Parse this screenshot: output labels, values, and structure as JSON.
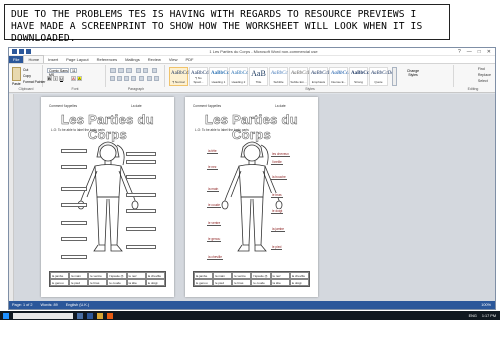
{
  "note": {
    "text": "DUE TO THE PROBLEMS TES IS HAVING WITH REGARDS TO RESOURCE PREVIEWS I HAVE MADE A SCREENPRINT TO SHOW HOW THE WORKSHEET WILL LOOK WHEN IT IS DOWNLOADED."
  },
  "window": {
    "title": "1 Les Parties du Corps - Microsoft Word non-commercial use",
    "controls": [
      "?",
      "—",
      "□",
      "✕"
    ]
  },
  "tabs": [
    "File",
    "Home",
    "Insert",
    "Page Layout",
    "References",
    "Mailings",
    "Review",
    "View",
    "PDF"
  ],
  "ribbon": {
    "clipboard": {
      "paste": "Paste",
      "cut": "Cut",
      "copy": "Copy",
      "format_painter": "Format Painter",
      "label": "Clipboard"
    },
    "font": {
      "name": "Comic Sans MS",
      "size": "11",
      "label": "Font",
      "buttons": [
        "B",
        "I",
        "U",
        "A",
        "A"
      ]
    },
    "paragraph": {
      "label": "Paragraph"
    },
    "styles": {
      "label": "Styles",
      "items": [
        {
          "sample": "AaBbCcDc",
          "name": "¶ Normal"
        },
        {
          "sample": "AaBbCcDc",
          "name": "¶ No Spaci..."
        },
        {
          "sample": "AaBbCc",
          "name": "Heading 1"
        },
        {
          "sample": "AaBbCc",
          "name": "Heading 2"
        },
        {
          "sample": "AaB",
          "name": "Title"
        },
        {
          "sample": "AaBbCc",
          "name": "Subtitle"
        },
        {
          "sample": "AaBbCcDc",
          "name": "Subtle Em..."
        },
        {
          "sample": "AaBbCcDc",
          "name": "Emphasis"
        },
        {
          "sample": "AaBbCcDc",
          "name": "Intense E..."
        },
        {
          "sample": "AaBbCcDc",
          "name": "Strong"
        },
        {
          "sample": "AaBbCcDc",
          "name": "Quote"
        }
      ],
      "change_styles": "Change Styles"
    },
    "editing": {
      "find": "Find",
      "replace": "Replace",
      "select": "Select",
      "label": "Editing"
    }
  },
  "page_left": {
    "name_label": "Comment t'appelles",
    "date_label": "La date",
    "title": "Les Parties du Corps",
    "objective": "L.O: To be able to label the body parts"
  },
  "page_right": {
    "name_label": "Comment t'appelles",
    "date_label": "La date",
    "title": "Les Parties du Corps",
    "objective": "L.O: To be able to label the body parts",
    "labels": [
      "la tête",
      "les cheveux",
      "l'oreille",
      "le nez",
      "la bouche",
      "la main",
      "le bras",
      "le coude",
      "le doigt",
      "le ventre",
      "la jambe",
      "le genou",
      "le pied",
      "la cheville"
    ]
  },
  "vocab": [
    "la jambe",
    "la main",
    "le ventre",
    "l'épaule (f)",
    "le nez",
    "la cheville",
    "le genou",
    "le pied",
    "le bras",
    "le coude",
    "la tête",
    "le doigt"
  ],
  "statusbar": {
    "page": "Page: 1 of 2",
    "words": "Words: 89",
    "language": "English (U.K.)",
    "zoom": "100%"
  },
  "taskbar": {
    "search": "Ask me anything",
    "lang": "ENG",
    "time": "1:17 PM"
  }
}
